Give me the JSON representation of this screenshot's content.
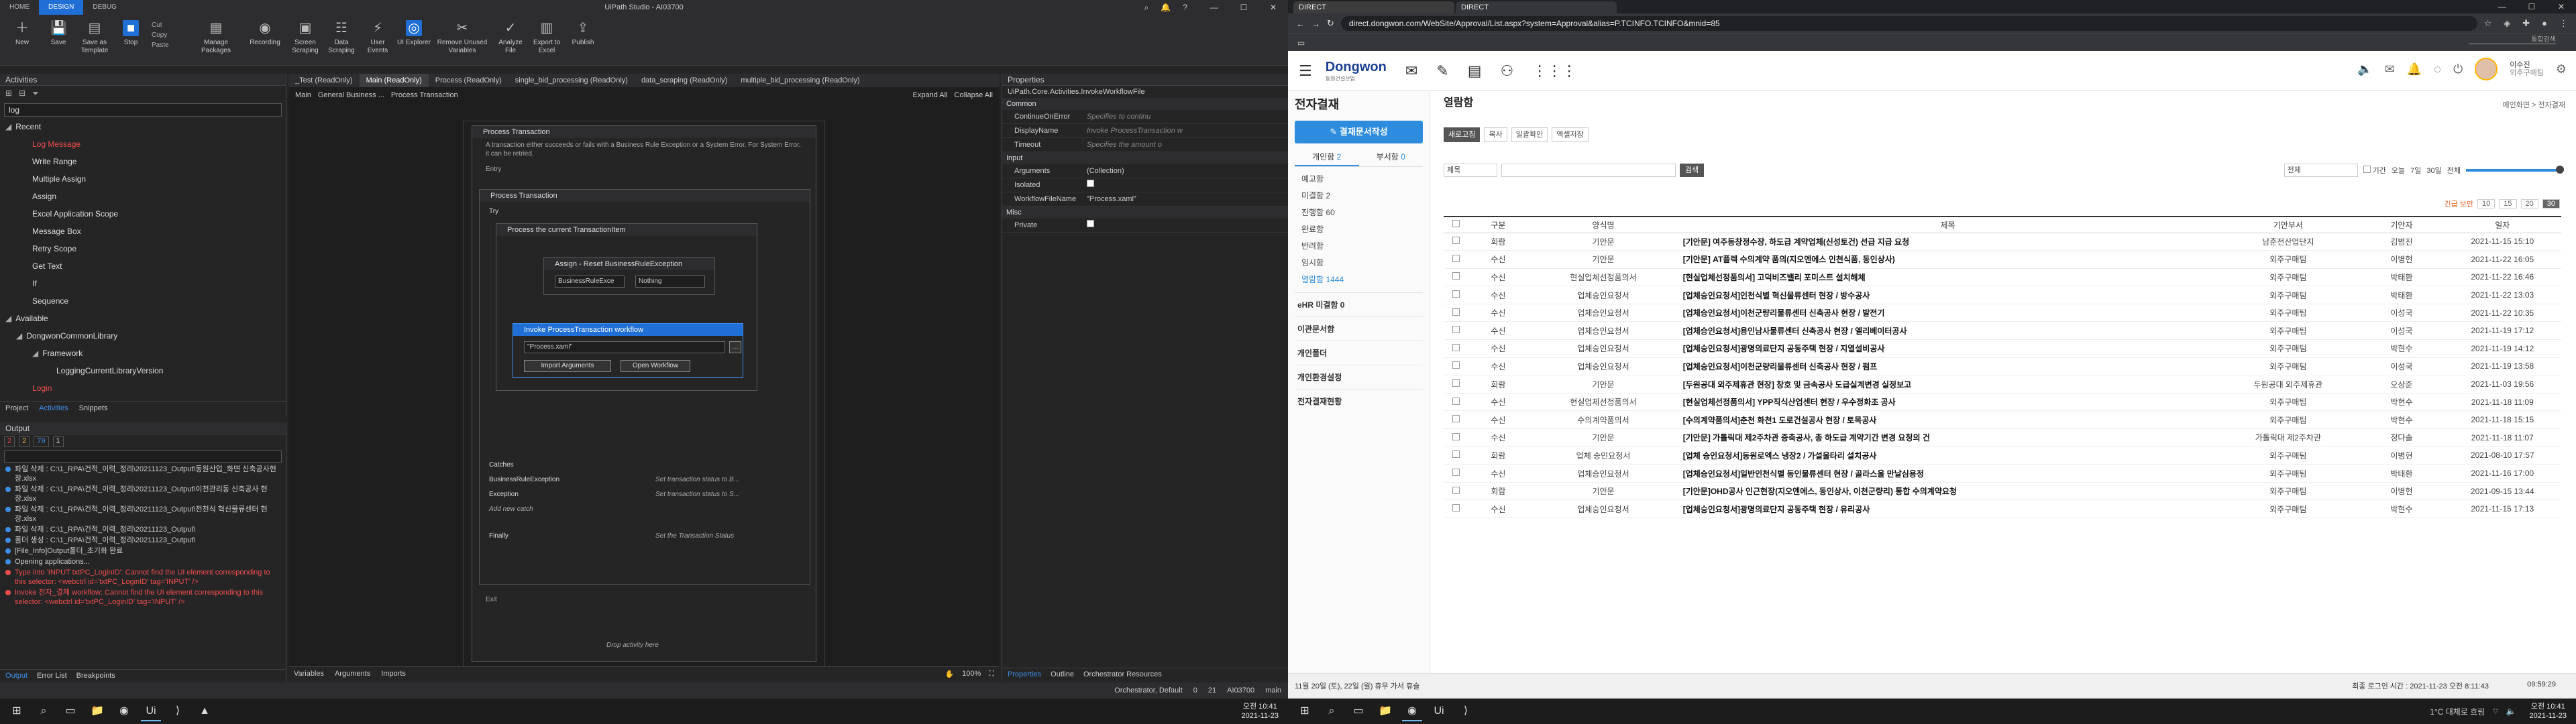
{
  "studio": {
    "title": "UiPath Studio - AI03700",
    "ribbon_tabs": [
      "HOME",
      "DESIGN",
      "DEBUG"
    ],
    "ribbon": {
      "new": "New",
      "save": "Save",
      "save_template": "Save as Template",
      "stop": "Stop",
      "cut": "Cut",
      "copy": "Copy",
      "paste": "Paste",
      "manage_packages": "Manage Packages",
      "recording": "Recording",
      "screen_scraping": "Screen Scraping",
      "data_scraping": "Data Scraping",
      "user_events": "User Events",
      "ui_explorer": "UI Explorer",
      "remove_unused": "Remove Unused Variables",
      "analyze_file": "Analyze File",
      "export_excel": "Export to Excel",
      "publish": "Publish"
    },
    "activities": {
      "header": "Activities",
      "search": "log",
      "recent": "Recent",
      "recent_items": [
        "Log Message",
        "Write Range",
        "Multiple Assign",
        "Assign",
        "Excel Application Scope",
        "Message Box",
        "Retry Scope",
        "Get Text",
        "If",
        "Sequence"
      ],
      "available": "Available",
      "lib": "DongwonCommonLibrary",
      "framework": "Framework",
      "lib_item": "LoggingCurrentLibraryVersion",
      "login": "Login",
      "footer": [
        "Project",
        "Activities",
        "Snippets"
      ]
    },
    "output": {
      "header": "Output",
      "counts": [
        "2",
        "2",
        "79",
        "1"
      ],
      "lines": [
        {
          "t": "파일 삭제 : C:\\1_RPA\\건적_이력_정리\\20211123_Output\\동원산업_화면 신축공사현장.xlsx",
          "err": false
        },
        {
          "t": "파일 삭제 : C:\\1_RPA\\건적_이력_정리\\20211123_Output\\이천관리동 신축공사 현장.xlsx",
          "err": false
        },
        {
          "t": "파일 삭제 : C:\\1_RPA\\건적_이력_정리\\20211123_Output\\전천식 혁신물류센터 현장.xlsx",
          "err": false
        },
        {
          "t": "파일 삭제 : C:\\1_RPA\\건적_이력_정리\\20211123_Output\\",
          "err": false
        },
        {
          "t": "폴더 생성 : C:\\1_RPA\\건적_이력_정리\\20211123_Output\\",
          "err": false
        },
        {
          "t": "[File_Info]Output폴더_초기화 완료",
          "err": false
        },
        {
          "t": "Opening applications...",
          "err": false
        },
        {
          "t": "Type into 'INPUT txtPC_LoginID': Cannot find the UI element corresponding to this selector: <webctrl id='txtPC_LoginID' tag='INPUT' />",
          "err": true
        },
        {
          "t": "Invoke 전자_결제 workflow: Cannot find the UI element corresponding to this selector: <webctrl id='txtPC_LoginID' tag='INPUT' />",
          "err": true
        }
      ],
      "footer": [
        "Output",
        "Error List",
        "Breakpoints"
      ]
    },
    "doc_tabs": [
      "_Test (ReadOnly)",
      "Main (ReadOnly)",
      "Process (ReadOnly)",
      "single_bid_processing (ReadOnly)",
      "data_scraping (ReadOnly)",
      "multiple_bid_processing (ReadOnly)"
    ],
    "breadcrumb": [
      "Main",
      "General Business ...",
      "Process Transaction"
    ],
    "expand_all": "Expand All",
    "collapse_all": "Collapse All",
    "workflow": {
      "root": "Process Transaction",
      "root_desc": "A transaction either succeeds or fails with a Business Rule Exception or a System Error. For System Error, it can be retried.",
      "entry": "Entry",
      "try_catch": "Process Transaction",
      "try": "Try",
      "seq": "Process the current TransactionItem",
      "assign": "Assign - Reset BusinessRuleException",
      "assign_to": "BusinessRuleExce",
      "assign_val": "Nothing",
      "invoke": "Invoke ProcessTransaction workflow",
      "invoke_file": "\"Process.xaml\"",
      "import_args": "Import Arguments",
      "open_wf": "Open Workflow",
      "catches": "Catches",
      "catch1": "BusinessRuleException",
      "catch1_hint": "Set transaction status to B...",
      "catch2": "Exception",
      "catch2_hint": "Set transaction status to S...",
      "add_catch": "Add new catch",
      "finally": "Finally",
      "finally_hint": "Set the Transaction Status",
      "exit": "Exit",
      "drop": "Drop activity here"
    },
    "designer_footer": [
      "Variables",
      "Arguments",
      "Imports"
    ],
    "zoom": "100%",
    "properties": {
      "header": "Properties",
      "type": "UiPath.Core.Activities.InvokeWorkflowFile",
      "common": "Common",
      "rows1": [
        [
          "ContinueOnError",
          "Specifies to continu"
        ],
        [
          "DisplayName",
          "Invoke ProcessTransaction w"
        ],
        [
          "Timeout",
          "Specifies the amount o"
        ]
      ],
      "input": "Input",
      "rows2": [
        [
          "Arguments",
          "(Collection)"
        ],
        [
          "Isolated",
          ""
        ],
        [
          "WorkflowFileName",
          "\"Process.xaml\""
        ]
      ],
      "misc": "Misc",
      "rows3": [
        [
          "Private",
          ""
        ]
      ],
      "footer": [
        "Properties",
        "Outline",
        "Orchestrator Resources"
      ]
    },
    "status": {
      "orchestrator": "Orchestrator, Default",
      "warn": "0",
      "count": "21",
      "robot": "AI03700",
      "branch": "main"
    }
  },
  "browser": {
    "tabs": [
      "DIRECT",
      "DIRECT"
    ],
    "url": "direct.dongwon.com/WebSite/Approval/List.aspx?system=Approval&alias=P.TCINFO.TCINFO&mnid=85",
    "top_search": "통합검색",
    "logo": "Dongwon",
    "logo_sub": "동원건설산업",
    "user": {
      "name": "이수진",
      "dept": "외주구매팀"
    },
    "lnb": {
      "title": "전자결재",
      "write": "결재문서작성",
      "tab1": "개인함",
      "tab1_count": "2",
      "tab2": "부서함",
      "tab2_count": "0",
      "items": [
        "예고함",
        "미결함 2",
        "진행함 60",
        "완료함",
        "반려함",
        "임시함",
        "열람함 1444"
      ],
      "sections": [
        "eHR 미결함 0",
        "이관문서함",
        "개인폴더",
        "개인환경설정",
        "전자결재현황"
      ]
    },
    "main": {
      "title": "열람함",
      "crumb": "메인화면 > 전자결재",
      "tools": [
        "새로고침",
        "복사",
        "일괄확인",
        "엑셀저장"
      ],
      "filter_field": "제목",
      "search_btn": "검색",
      "scope": "전체",
      "period_label": "기간",
      "periods": [
        "오늘",
        "7일",
        "30일",
        "전체"
      ],
      "legend": "긴급  보안",
      "page_sizes": [
        "10",
        "15",
        "20",
        "30"
      ],
      "columns": [
        "구분",
        "양식명",
        "제목",
        "기안부서",
        "기안자",
        "일자"
      ],
      "rows": [
        [
          "회람",
          "기안문",
          "[기안문] 여주동창정수장, 하도급 계약업체(신성토건) 선급 지급 요청",
          "남준전산업단지",
          "김범진",
          "2021-11-15 15:10"
        ],
        [
          "수신",
          "기안문",
          "[기안문] AT플렉 수의계약 품의(지오엔에스 인천식품, 동인상사)",
          "외주구매팀",
          "이병현",
          "2021-11-22 16:05"
        ],
        [
          "수신",
          "현실업체선정품의서",
          "[현실업체선정품의서] 고덕비즈밸리 포미스트 설치해체",
          "외주구매팀",
          "박태환",
          "2021-11-22 16:46"
        ],
        [
          "수신",
          "업체승인요청서",
          "[업체승인요청서]인천식별 혁신물류센터 현장 / 방수공사",
          "외주구매팀",
          "박태환",
          "2021-11-22 13:03"
        ],
        [
          "수신",
          "업체승인요청서",
          "[업체승인요청서]이천군량리물류센터 신축공사 현장 / 발전기",
          "외주구매팀",
          "이성국",
          "2021-11-22 10:35"
        ],
        [
          "수신",
          "업체승인요청서",
          "[업체승인요청서]용인남사물류센터 신축공사 현장 / 엘리베이터공사",
          "외주구매팀",
          "이성국",
          "2021-11-19 17:12"
        ],
        [
          "수신",
          "업체승인요청서",
          "[업체승인요청서]광명의료단지 공동주택 현장 / 지열설비공사",
          "외주구매팀",
          "박현수",
          "2021-11-19 14:12"
        ],
        [
          "수신",
          "업체승인요청서",
          "[업체승인요청서]이천군량리물류센터 신축공사 현장 / 펌프",
          "외주구매팀",
          "이성국",
          "2021-11-19 13:58"
        ],
        [
          "회람",
          "기안문",
          "[두원공대 외주제휴관 현장] 창호 및 금속공사 도급실계변경 실정보고",
          "두원공대 외주제휴관",
          "오상준",
          "2021-11-03 19:56"
        ],
        [
          "수신",
          "현실업체선정품의서",
          "[현실업체선정품의서] YPP직식산업센터 현장 / 우수정화조 공사",
          "외주구매팀",
          "박현수",
          "2021-11-18 11:09"
        ],
        [
          "수신",
          "수의계약품의서",
          "[수의계약품의서]춘천 화천1 도로건설공사 현장 / 토목공사",
          "외주구매팀",
          "박현수",
          "2021-11-18 15:15"
        ],
        [
          "수신",
          "기안문",
          "[기안문] 가톨릭대 제2주차관 증축공사, 총 하도급 계약기간 변경 요청의 건",
          "가톨릭대 제2주차관",
          "정다솔",
          "2021-11-18 11:07"
        ],
        [
          "회람",
          "업체 승인요청서",
          "[업체 승인요청서]동원로엑스 냉장2 / 가설울타리 설치공사",
          "외주구매팀",
          "이병현",
          "2021-08-10 17:57"
        ],
        [
          "수신",
          "업체승인요청서",
          "[업체승인요청서]일반인천식별 동인물류센터 현장 / 골라스울 만날심용정",
          "외주구매팀",
          "박태환",
          "2021-11-16 17:00"
        ],
        [
          "회람",
          "기안문",
          "[기안문]OHD공사 인근현장(지오엔에스, 동인상사, 이천군량리) 통합 수의계약요청",
          "외주구매팀",
          "이병현",
          "2021-09-15 13:44"
        ],
        [
          "수신",
          "업체승인요청서",
          "[업체승인요청서]광명의료단지 공동주택 현장 / 유리공사",
          "외주구매팀",
          "박현수",
          "2021-11-15 17:13"
        ]
      ]
    },
    "statusbar": "11월 20일 (토), 22일 (월) 휴무 가서 휴슬",
    "login_time": "최종 로그인 시간 : 2021-11-23 오전 8:11:43",
    "session": "09:59:29"
  },
  "taskbar": {
    "left_time": "오전 10:41",
    "left_date": "2021-11-23",
    "right_time": "오전 10:41",
    "right_date": "2021-11-23",
    "weather": "1°C 대체로 흐림"
  }
}
